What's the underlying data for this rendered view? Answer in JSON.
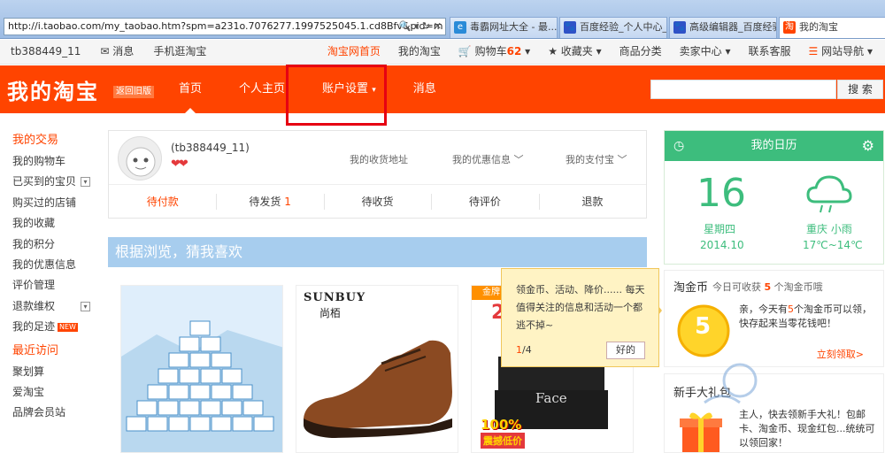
{
  "browser": {
    "url": "http://i.taobao.com/my_taobao.htm?spm=a231o.7076277.1997525045.1.cd8Bfv&pid=m",
    "tabs": [
      {
        "label": "毒霸网址大全 - 最...",
        "color": "#2a8bd8",
        "icon": "e"
      },
      {
        "label": "百度经验_个人中心_...",
        "color": "#2f52c7",
        "icon": "🐾"
      },
      {
        "label": "高级编辑器_百度经验",
        "color": "#2f52c7",
        "icon": "🐾"
      },
      {
        "label": "我的淘宝",
        "color": "#ff4400",
        "icon": "淘"
      }
    ]
  },
  "topbar": {
    "user": "tb388449_11",
    "messages": "消息",
    "mobile": "手机逛淘宝",
    "home": "淘宝网首页",
    "my_taobao": "我的淘宝",
    "cart": "购物车",
    "cart_count": "62",
    "favorites": "收藏夹",
    "categories": "商品分类",
    "seller": "卖家中心",
    "service": "联系客服",
    "sitenav": "网站导航"
  },
  "nav": {
    "logo": "我的淘宝",
    "logo_sub": "返回旧版",
    "items": [
      "首页",
      "个人主页",
      "账户设置",
      "消息"
    ],
    "search_button": "搜 索",
    "search_placeholder": ""
  },
  "sidebar": {
    "section1": "我的交易",
    "items1": [
      "我的购物车",
      "已买到的宝贝",
      "购买过的店铺",
      "我的收藏",
      "我的积分",
      "我的优惠信息",
      "评价管理",
      "退款维权",
      "我的足迹"
    ],
    "new_badge": "NEW",
    "section2": "最近访问",
    "items2": [
      "聚划算",
      "爱淘宝",
      "品牌会员站"
    ]
  },
  "profile": {
    "username": "(tb388449_11)",
    "hearts": "❤❤",
    "address": "我的收货地址",
    "coupons": "我的优惠信息",
    "alipay": "我的支付宝",
    "stats": [
      {
        "label": "待付款",
        "count": ""
      },
      {
        "label": "待发货",
        "count": "1"
      },
      {
        "label": "待收货",
        "count": ""
      },
      {
        "label": "待评价",
        "count": ""
      },
      {
        "label": "退款",
        "count": ""
      }
    ]
  },
  "guess": {
    "title": "根据浏览，猜我喜欢"
  },
  "products": {
    "p2_brand": "SUNBUY",
    "p2_brand_cn": "尚栢",
    "p3_tag": "金牌",
    "p3_num": "2",
    "p3_face": "Face",
    "p3_percent": "100%",
    "p3_promo": "震撼低价"
  },
  "tip": {
    "text": "领金币、活动、降价...... 每天值得关注的信息和活动一个都逃不掉~",
    "page_current": "1",
    "page_total": "/4",
    "ok": "好的"
  },
  "calendar": {
    "title": "我的日历",
    "day": "16",
    "weekday": "星期四",
    "date": "2014.10",
    "city": "重庆 小雨",
    "temp": "17℃~14℃",
    "accent": "#3dbd7d"
  },
  "gold": {
    "title": "淘金币",
    "sub_prefix": "今日可收获",
    "sub_count": "5",
    "sub_suffix": "个淘金币哦",
    "coin": "5",
    "msg_a": "亲，今天有",
    "msg_count": "5",
    "msg_b": "个淘金币可以领，快存起来当零花钱吧！",
    "link": "立刻领取>"
  },
  "newbie": {
    "title": "新手大礼包",
    "msg": "主人，快去领新手大礼！包邮卡、淘金币、现金红包...统统可以领回家！"
  }
}
